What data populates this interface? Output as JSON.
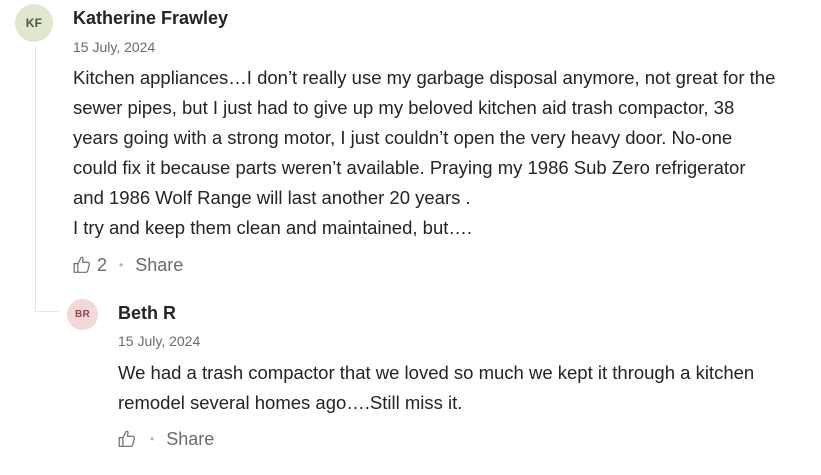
{
  "comments": [
    {
      "avatar_initials": "KF",
      "author": "Katherine Frawley",
      "date": "15 July, 2024",
      "body": "Kitchen appliances…I don’t really use my garbage disposal anymore, not great for the\nsewer pipes, but I just had to give up my beloved kitchen aid trash compactor, 38\nyears going with a strong motor, I just couldn’t open the very heavy door. No-one\ncould fix it because parts weren’t available. Praying my 1986 Sub Zero refrigerator\nand 1986 Wolf Range will last another 20 years .\nI try  and keep them clean and maintained, but….",
      "clap_count": "2",
      "dot": "•",
      "share_label": "Share",
      "clap_icon": "clap-icon"
    },
    {
      "avatar_initials": "BR",
      "author": "Beth R",
      "date": "15 July, 2024",
      "body": "We had a trash compactor that we loved so much we kept it through a kitchen\nremodel several homes ago….Still miss it.",
      "dot": "•",
      "share_label": "Share",
      "clap_icon": "clap-icon"
    }
  ],
  "colors": {
    "text": "#242424",
    "muted": "#6b6b6b",
    "avatar_kf_bg": "#dfe8cf",
    "avatar_br_bg": "#f2d8d8",
    "thread_line": "#e6e6e6"
  }
}
